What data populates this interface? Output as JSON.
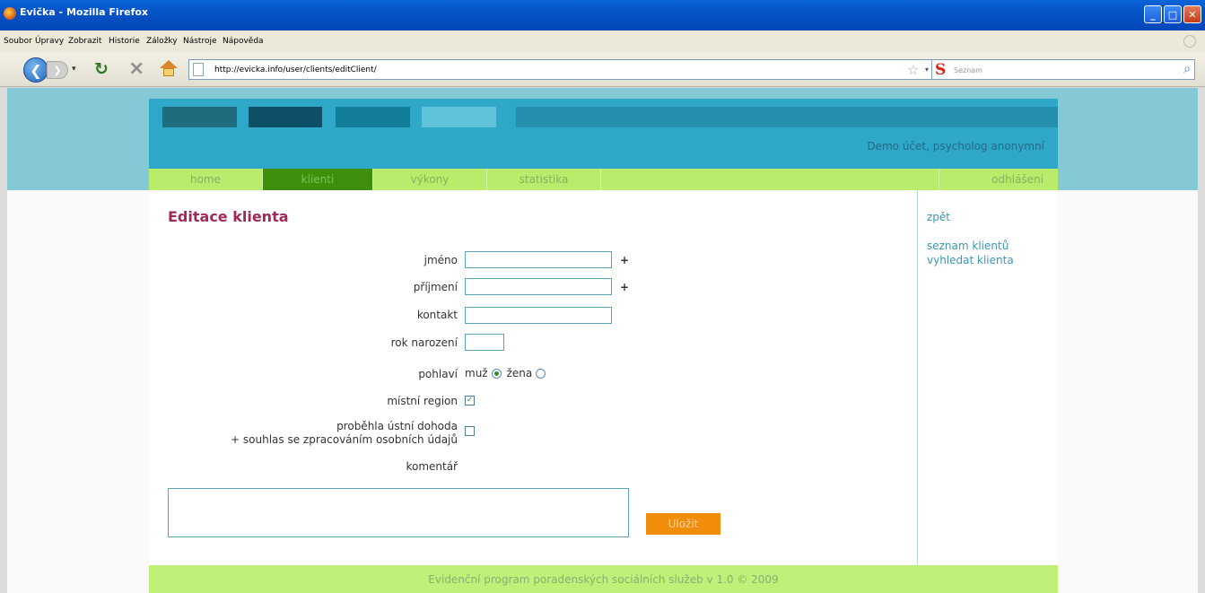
{
  "window": {
    "title": "Evička - Mozilla Firefox",
    "min": "_",
    "max": "□",
    "close": "✕"
  },
  "menu": {
    "items": [
      "Soubor",
      "Úpravy",
      "Zobrazit",
      "Historie",
      "Záložky",
      "Nástroje",
      "Nápověda"
    ]
  },
  "toolbar": {
    "url": "http://evicka.info/user/clients/editClient/",
    "search_engine": "S",
    "search_placeholder": "Seznam"
  },
  "header": {
    "user": "Demo účet, psycholog anonymní"
  },
  "nav": {
    "home": "home",
    "clients": "klienti",
    "services": "výkony",
    "stats": "statistika",
    "logout": "odhlášení"
  },
  "form": {
    "title": "Editace klienta",
    "first_name_label": "jméno",
    "last_name_label": "příjmení",
    "contact_label": "kontakt",
    "birth_year_label": "rok narození",
    "gender_label": "pohlaví",
    "gender_male": "muž",
    "gender_female": "žena",
    "gender_selected": "muž",
    "region_label": "místní region",
    "region_checked": true,
    "agreement_label_1": "proběhla ústní dohoda",
    "agreement_label_2": "+ souhlas se zpracováním osobních údajů",
    "agreement_checked": false,
    "comment_label": "komentář",
    "required_marker": "+",
    "save_label": "Uložit"
  },
  "sidebar": {
    "back": "zpět",
    "client_list": "seznam klientů",
    "find_client": "vyhledat klienta"
  },
  "footer": {
    "text": "Evidenční program poradenských sociálních služeb v 1.0 © 2009"
  }
}
